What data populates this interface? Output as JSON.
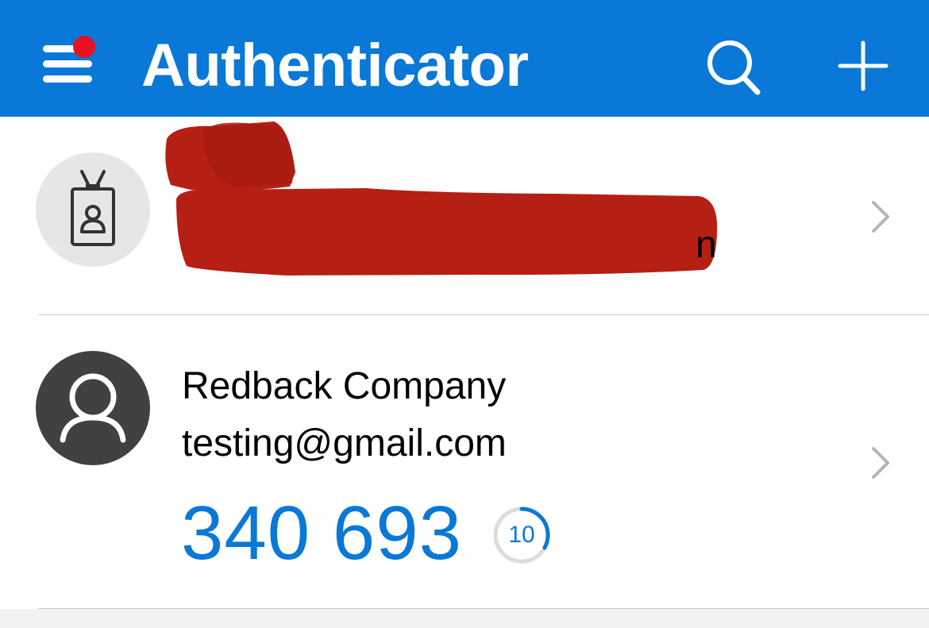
{
  "header": {
    "title": "Authenticator",
    "background": "#0a78d6",
    "notification_dot_color": "#e81123",
    "icons": [
      "menu-icon",
      "search-icon",
      "plus-icon"
    ]
  },
  "accounts": [
    {
      "icon": "badge-icon",
      "redacted": true,
      "redaction_color": "#b51f14",
      "visible_text_tail": "n"
    },
    {
      "icon": "person-icon",
      "name": "Redback Company",
      "email": "testing@gmail.com",
      "code": "340 693",
      "seconds_remaining": "10",
      "timer_progress": 0.33
    }
  ],
  "colors": {
    "accent": "#0a78d6",
    "divider": "#c8c8c8"
  }
}
